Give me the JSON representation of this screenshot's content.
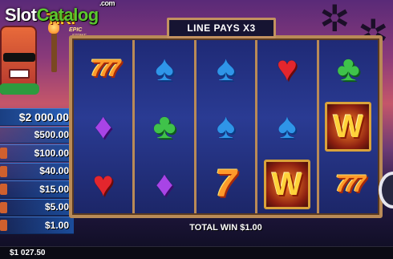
{
  "watermark": {
    "slot": "Slot",
    "catalog": "Catalog",
    "com": ".com"
  },
  "game_title": {
    "line1": "TIKI",
    "line2": "EPIC",
    "line3": "STRIKE"
  },
  "banner": {
    "text": "LINE PAYS X3"
  },
  "paytable": [
    "$2 000.00",
    "$500.00",
    "$100.00",
    "$40.00",
    "$15.00",
    "$5.00",
    "$1.00"
  ],
  "reels": [
    [
      {
        "type": "seven-triple",
        "label": "777",
        "name": "triple-seven-symbol"
      },
      {
        "type": "diamond",
        "label": "♦",
        "name": "diamond-symbol"
      },
      {
        "type": "heart",
        "label": "♥",
        "name": "heart-symbol"
      }
    ],
    [
      {
        "type": "spade",
        "label": "♠",
        "name": "spade-symbol"
      },
      {
        "type": "club",
        "label": "♣",
        "name": "club-symbol"
      },
      {
        "type": "diamond",
        "label": "♦",
        "name": "diamond-symbol"
      }
    ],
    [
      {
        "type": "spade",
        "label": "♠",
        "name": "spade-symbol"
      },
      {
        "type": "spade",
        "label": "♠",
        "name": "spade-symbol"
      },
      {
        "type": "seven",
        "label": "7",
        "name": "seven-symbol"
      }
    ],
    [
      {
        "type": "heart",
        "label": "♥",
        "name": "heart-symbol"
      },
      {
        "type": "spade",
        "label": "♠",
        "name": "spade-symbol"
      },
      {
        "type": "wild",
        "label": "W",
        "name": "wild-symbol"
      }
    ],
    [
      {
        "type": "club",
        "label": "♣",
        "name": "club-symbol"
      },
      {
        "type": "wild",
        "label": "W",
        "name": "wild-symbol"
      },
      {
        "type": "seven-triple",
        "label": "777",
        "name": "triple-seven-symbol"
      }
    ]
  ],
  "total_win": {
    "label": "TOTAL WIN",
    "value": "$1.00"
  },
  "credit": {
    "value": "$1 027.50"
  },
  "colors": {
    "frame": "#b98a57",
    "reel_bg": "#2a3b93",
    "paytable_bg": "#1b4c9a",
    "sky": "#c5566a"
  }
}
